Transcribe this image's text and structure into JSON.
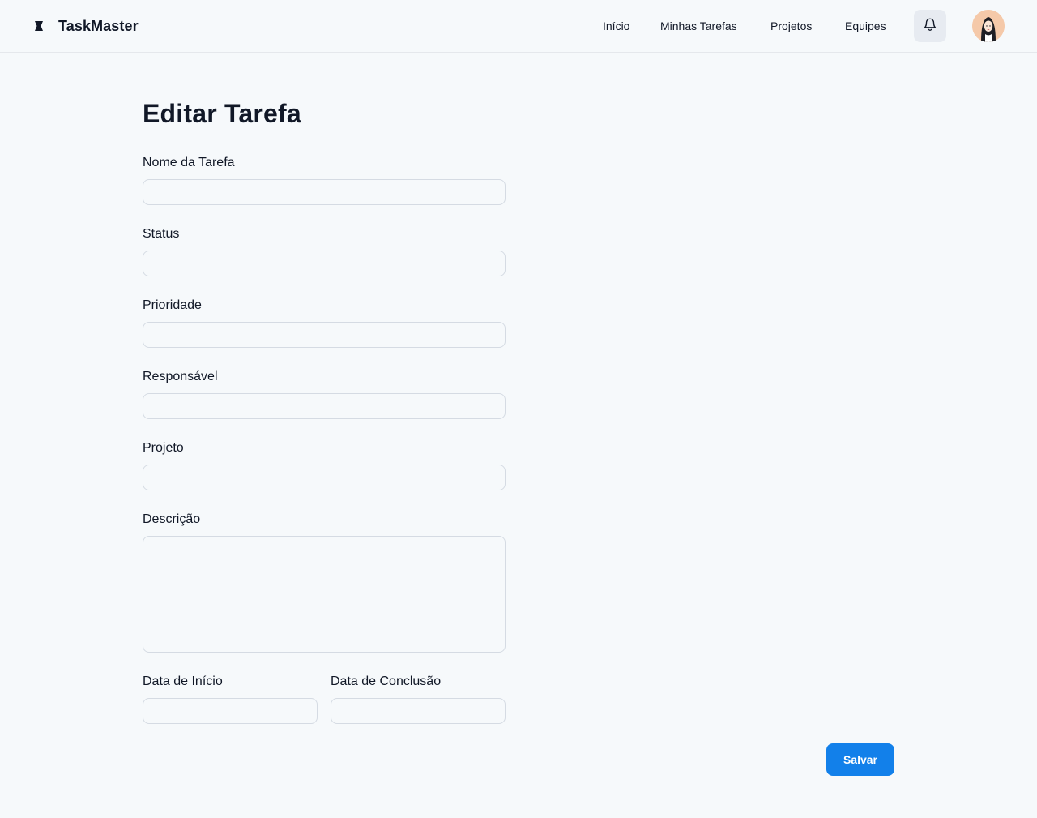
{
  "header": {
    "brand_name": "TaskMaster",
    "nav": [
      "Início",
      "Minhas Tarefas",
      "Projetos",
      "Equipes"
    ]
  },
  "form": {
    "title": "Editar Tarefa",
    "fields": [
      {
        "label": "Nome da Tarefa",
        "value": ""
      },
      {
        "label": "Status",
        "value": ""
      },
      {
        "label": "Prioridade",
        "value": ""
      },
      {
        "label": "Responsável",
        "value": ""
      },
      {
        "label": "Projeto",
        "value": ""
      },
      {
        "label": "Descrição",
        "value": ""
      },
      {
        "label": "Data de Início",
        "value": ""
      },
      {
        "label": "Data de Conclusão",
        "value": ""
      }
    ],
    "save_label": "Salvar"
  },
  "colors": {
    "accent": "#1280ea",
    "background": "#f6f9fb",
    "border": "#d5dbe3"
  },
  "icons": [
    "brand-logo-icon",
    "bell-icon",
    "user-avatar"
  ]
}
